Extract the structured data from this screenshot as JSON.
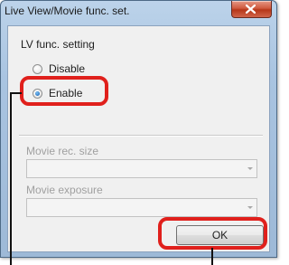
{
  "window": {
    "title": "Live View/Movie func. set.",
    "close_icon": "close-x-icon"
  },
  "lv_func": {
    "group_title": "LV func. setting",
    "options": [
      {
        "label": "Disable",
        "checked": false
      },
      {
        "label": "Enable",
        "checked": true
      }
    ]
  },
  "movie": {
    "rec_size_label": "Movie rec. size",
    "rec_size_value": "",
    "exposure_label": "Movie exposure",
    "exposure_value": ""
  },
  "buttons": {
    "ok_label": "OK"
  },
  "colors": {
    "callout": "#e0201c",
    "leader_line": "#111111"
  }
}
